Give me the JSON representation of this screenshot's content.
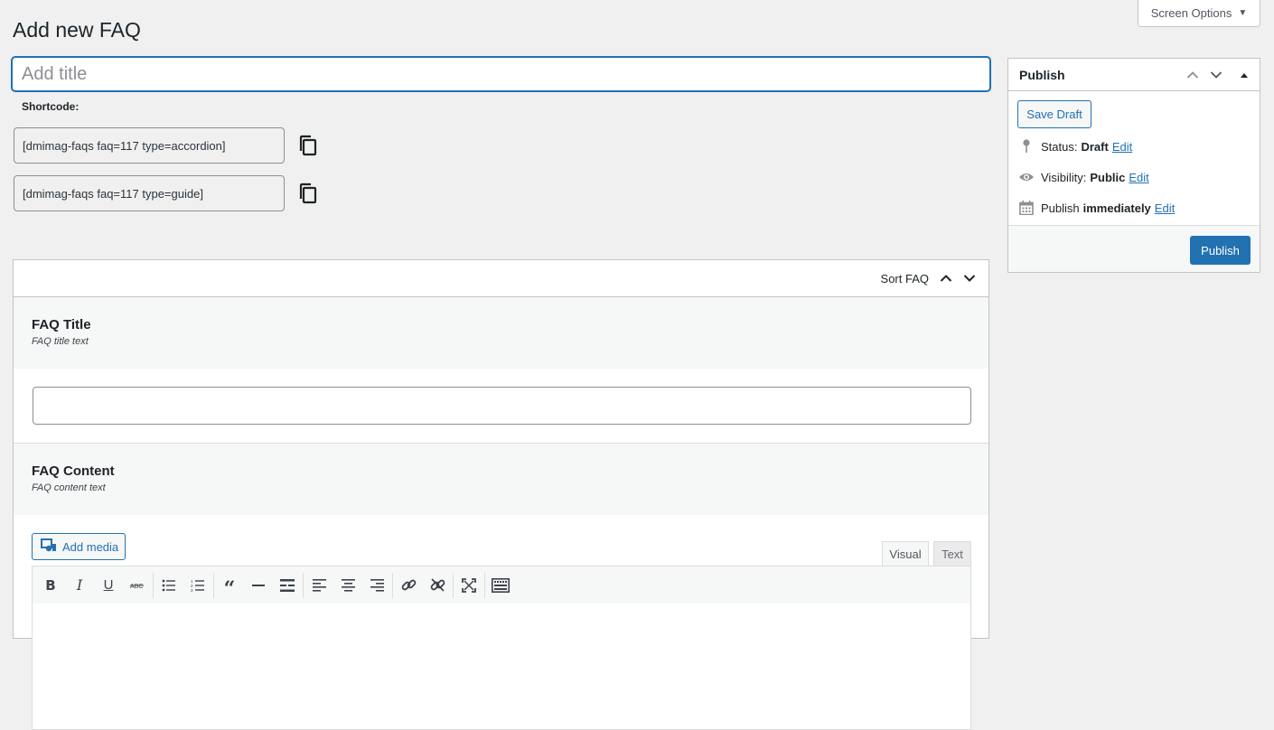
{
  "screen_options": {
    "label": "Screen Options",
    "arrow": "▼"
  },
  "page": {
    "title": "Add new FAQ"
  },
  "title_field": {
    "placeholder": "Add title",
    "value": ""
  },
  "shortcode": {
    "label": "Shortcode:",
    "items": [
      "[dmimag-faqs faq=117 type=accordion]",
      "[dmimag-faqs faq=117 type=guide]"
    ]
  },
  "faq_box": {
    "sort_label": "Sort FAQ",
    "faq_title": {
      "title": "FAQ Title",
      "desc": "FAQ title text",
      "value": ""
    },
    "faq_content": {
      "title": "FAQ Content",
      "desc": "FAQ content text"
    },
    "editor": {
      "add_media_label": "Add media",
      "tabs": {
        "visual": "Visual",
        "text": "Text"
      },
      "toolbar_icons": [
        "bold-icon",
        "italic-icon",
        "underline-icon",
        "strikethrough-icon",
        "bullet-list-icon",
        "numbered-list-icon",
        "blockquote-icon",
        "horizontal-rule-icon",
        "read-more-icon",
        "align-left-icon",
        "align-center-icon",
        "align-right-icon",
        "link-icon",
        "unlink-icon",
        "fullscreen-icon",
        "toolbar-toggle-icon"
      ]
    }
  },
  "publish": {
    "title": "Publish",
    "save_draft": "Save Draft",
    "status_label": "Status:",
    "status_value": "Draft",
    "visibility_label": "Visibility:",
    "visibility_value": "Public",
    "publish_label": "Publish",
    "publish_value": "immediately",
    "edit_label": "Edit",
    "publish_button": "Publish"
  }
}
